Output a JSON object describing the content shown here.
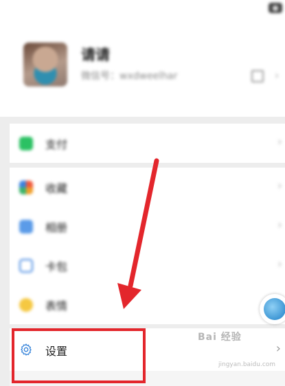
{
  "profile": {
    "nickname": "请请",
    "wechat_id": "微信号：wxdweelhar",
    "chevron": "›"
  },
  "menu": [
    {
      "label": "支付",
      "icon": "pay-icon",
      "color": "#2bc163",
      "chevron": "›"
    },
    {
      "label": "收藏",
      "icon": "favorites-icon",
      "color": "#f0a02c",
      "chevron": "›"
    },
    {
      "label": "相册",
      "icon": "album-icon",
      "color": "#3b82e0",
      "chevron": "›"
    },
    {
      "label": "卡包",
      "icon": "cards-icon",
      "color": "#3b82e0",
      "chevron": "›"
    },
    {
      "label": "表情",
      "icon": "sticker-icon",
      "color": "#f5c842",
      "chevron": "›"
    }
  ],
  "settings": {
    "label": "设置",
    "icon": "gear-icon",
    "color": "#2f7fd8",
    "chevron": "›"
  },
  "annotation": {
    "arrow_color": "#e3262c",
    "box_color": "#e3262c"
  },
  "watermark": {
    "text": "Bai 经验",
    "sub": "jingyan.baidu.com"
  }
}
